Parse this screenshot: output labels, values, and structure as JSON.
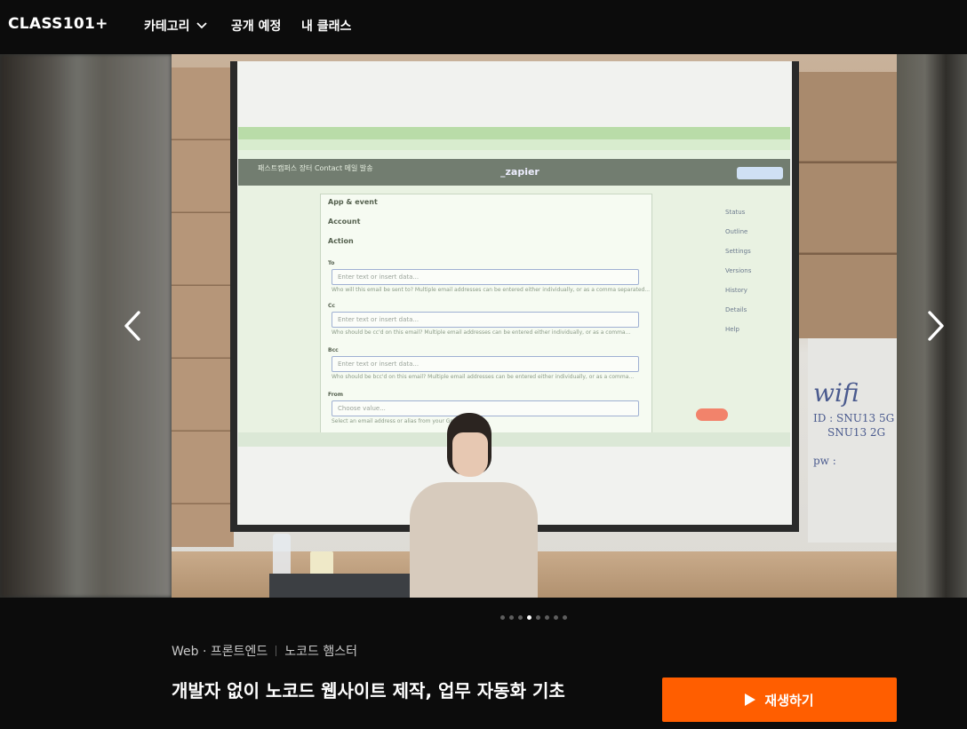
{
  "header": {
    "logo": "CLASS101+",
    "nav": {
      "category": "카테고리",
      "upcoming": "공개 예정",
      "my_class": "내 클래스"
    }
  },
  "carousel": {
    "prev_icon": "chevron-left-icon",
    "next_icon": "chevron-right-icon",
    "total_slides": 8,
    "active_slide": 4,
    "slide_text": {
      "screen_title": "패스트캠퍼스 장터 Contact 메일 발송",
      "screen_logo": "_zapier",
      "whiteboard_wifi": "wifi",
      "whiteboard_id": "ID : SNU13 5G",
      "whiteboard_id2": "SNU13 2G",
      "whiteboard_pw": "pw : "
    }
  },
  "course": {
    "category": "Web · 프론트엔드",
    "creator": "노코드 햄스터",
    "title": "개발자 없이 노코드 웹사이트 제작, 업무 자동화 기초",
    "play_label": "재생하기"
  },
  "colors": {
    "accent": "#ff5e00",
    "background": "#0c0c0c"
  }
}
